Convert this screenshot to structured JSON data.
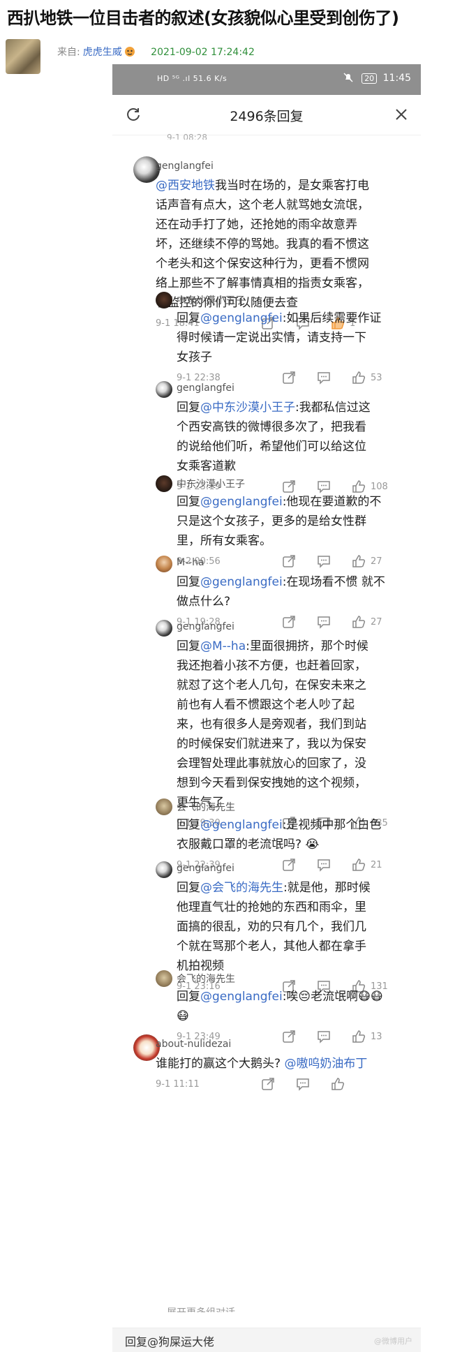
{
  "article": {
    "title": "西扒地铁一位目击者的叙述(女孩貌似心里受到创伤了)",
    "from_label": "来自:",
    "author": "虎虎生威",
    "date": "2021-09-02 17:24:42"
  },
  "statusbar": {
    "left": "HD ⁵ᴳ .ıl 51.6 K/s",
    "battery": "20",
    "time": "11:45"
  },
  "sheet": {
    "count_title": "2496条回复",
    "clipped_prev": "9-1 08:28"
  },
  "comments": [
    {
      "user": "genglangfei",
      "mention": "@西安地铁",
      "lines": [
        "我当时在场的，是女乘客打电",
        "话声音有点大，这个老人就骂她女流氓，",
        "还在动手打了她，还抢她的雨伞故意弄",
        "坏，还继续不停的骂她。我真的看不惯这",
        "个老头和这个保安这种行为，更看不惯网",
        "络上那些不了解事情真相的指责女乘客，",
        "有监控的你们可以随便去查"
      ],
      "time": "9-1 18:41",
      "likes": "1"
    },
    {
      "user": "中东沙漠小王子",
      "prefix": "回复",
      "mention": "@genglangfei",
      "lines": [
        ":如果后续需要作证",
        "得时候请一定说出实情，请支持一下",
        "女孩子"
      ],
      "time": "9-1 22:38",
      "likes": "53"
    },
    {
      "user": "genglangfei",
      "prefix": "回复",
      "mention": "@中东沙漠小王子",
      "lines": [
        ":我都私信过这",
        "个西安高铁的微博很多次了，把我看",
        "的说给他们听，希望他们可以给这位",
        "女乘客道歉"
      ],
      "time": "9-1 23:19",
      "likes": "108"
    },
    {
      "user": "中东沙漠小王子",
      "prefix": "回复",
      "mention": "@genglangfei",
      "lines": [
        ":他现在要道歉的不",
        "只是这个女孩子，更多的是给女性群",
        "里，所有女乘客。"
      ],
      "time": "9-2 00:56",
      "likes": "27"
    },
    {
      "user": "M--ha",
      "prefix": "回复",
      "mention": "@genglangfei",
      "lines": [
        ":在现场看不惯 就不",
        "做点什么?"
      ],
      "time": "9-1 19:28",
      "likes": "27"
    },
    {
      "user": "genglangfei",
      "prefix": "回复",
      "mention": "@M--ha",
      "lines": [
        ":里面很拥挤，那个时候",
        "我还抱着小孩不方便，也赶着回家，",
        "就怼了这个老人几句，在保安未来之",
        "前也有人看不惯跟这个老人吵了起",
        "来，也有很多人是旁观者，我们到站",
        "的时候保安们就进来了，我以为保安",
        "会理智处理此事就放心的回家了，没",
        "想到今天看到保安拽她的这个视频，",
        "更生气了"
      ],
      "time": "9-1 19:30",
      "likes": "335"
    },
    {
      "user": "会飞的海先生",
      "prefix": "回复",
      "mention": "@genglangfei",
      "lines": [
        ":是视频中那个白色",
        "衣服戴口罩的老流氓吗? 😭"
      ],
      "time": "9-1 22:39",
      "likes": "21"
    },
    {
      "user": "genglangfei",
      "prefix": "回复",
      "mention": "@会飞的海先生",
      "lines": [
        ":就是他，那时候",
        "他理直气壮的抢她的东西和雨伞，里",
        "面搞的很乱，劝的只有几个，我们几",
        "个就在骂那个老人，其他人都在拿手",
        "机拍视频"
      ],
      "time": "9-1 23:16",
      "likes": "131"
    },
    {
      "user": "会飞的海先生",
      "prefix": "回复",
      "mention": "@genglangfei",
      "lines": [
        ":唉😔老流氓啊😷😷",
        "😷"
      ],
      "time": "9-1 23:49",
      "likes": "13"
    },
    {
      "user": "about-nulidezai",
      "mention": "@嗷呜奶油布丁",
      "lines": [
        "谁能打的赢这个大鹅头? "
      ],
      "time": "9-1 11:11",
      "likes": ""
    }
  ],
  "expand_more": "展开更多组对话",
  "reply_box": {
    "placeholder": "回复@狗屎运大佬",
    "watermark": "@微博用户"
  },
  "icons": [
    "refresh-icon",
    "close-icon",
    "share-icon",
    "comment-icon",
    "like-icon",
    "wifi-icon",
    "mute-icon"
  ],
  "colors": {
    "mention": "#3a6bc4",
    "date": "#2f8f3a",
    "like_active": "#f39a3a",
    "statusbar": "#8f8f8f"
  }
}
